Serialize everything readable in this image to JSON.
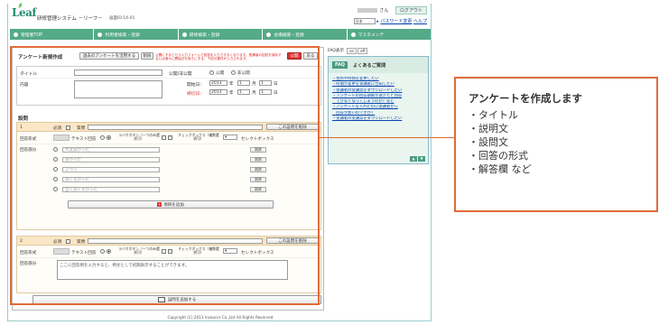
{
  "header": {
    "logo": "Leaf",
    "system_title": "研修管理システム －リーフ－",
    "screen_id": "画面ID:14-01",
    "user_suffix": "さん",
    "logout": "ログアウト",
    "lang_value": "日本",
    "password_change": "パスワード変更",
    "help": "ヘルプ"
  },
  "nav": [
    {
      "label": "管理者TOP",
      "icon": "home-icon"
    },
    {
      "label": "利用者検索・登録",
      "icon": "user-icon"
    },
    {
      "label": "研修検索・登録",
      "icon": "training-icon"
    },
    {
      "label": "会場検索・登録",
      "icon": "venue-icon"
    },
    {
      "label": "マスタメンテ",
      "icon": "master-icon"
    }
  ],
  "form": {
    "title": "アンケート新規作成",
    "reuse_button": "過去のアンケートを活用する",
    "delete_button": "削除",
    "warning": "公開にするともう入力フォームで回答を入力できなくなります。受講者の回答を保存するには個々に開始日を後ろにする、下記の要件が入力されます。",
    "publish_button": "公開",
    "back_button": "戻る",
    "title_label": "タイトル",
    "visibility_label": "公開/非公開",
    "public": "公開",
    "private": "非公開",
    "content_label": "内容",
    "start_label": "開始日：",
    "end_label": "締切日：",
    "year_value": "2013",
    "month_value": "1",
    "day_value": "1",
    "year_unit": "年",
    "month_unit": "月",
    "day_unit": "日"
  },
  "questions_label": "設問",
  "questions": [
    {
      "number": "1",
      "required": "必須",
      "question_label": "質問",
      "delete_question": "この設問を削除",
      "format_label": "回答形式",
      "text_answer": "テキスト回答",
      "radio_label": "ラジオボタン（一つのみ選択可）",
      "checkbox_label": "チェックボックス（複数選択可）",
      "select_box": "セレクトボックス",
      "answers_label": "回答部分",
      "answers": [
        "大変良かった",
        "良かった",
        "ふつう",
        "良くなかった",
        "全く良くなかった"
      ],
      "delete_answer": "削除",
      "add_item": "項目を追加"
    },
    {
      "number": "2",
      "required": "必須",
      "question_label": "質問",
      "delete_question": "この設問を削除",
      "format_label": "回答形式",
      "text_answer": "テキスト回答",
      "radio_label": "ラジオボタン（一つのみ選択可）",
      "checkbox_label": "チェックボックス（複数選択可）",
      "select_box": "セレクトボックス",
      "answers_label": "回答部分",
      "answer_placeholder": "ここに回答例を入力すると、例文として初期表示することができます。"
    }
  ],
  "add_question": "設問を追加する",
  "faq": {
    "display_label": "FAQ表示",
    "on": "on",
    "off": "off",
    "badge": "FAQ",
    "title": "よくあるご質問",
    "items": [
      "・住所や時間を変更したい",
      "・時間が変更を受講者に告知したい",
      "・受講者の受講票をダウンロードしたい",
      "・アンケートの回答期限が過ぎたと回答",
      "　できなくなってしまうのか？など",
      "・アンケートを入れたのに受講者から",
      "　回答が無いのですが？",
      "・受講者の受講票をダウンロードしたい"
    ]
  },
  "footer": "Copyright (C) 2013 insource Co.,Ltd All Rights Reserved",
  "callout": {
    "title": "アンケートを作成します",
    "items": [
      "・タイトル",
      "・説明文",
      "・設問文",
      "・回答の形式",
      "・解答欄 など"
    ]
  }
}
